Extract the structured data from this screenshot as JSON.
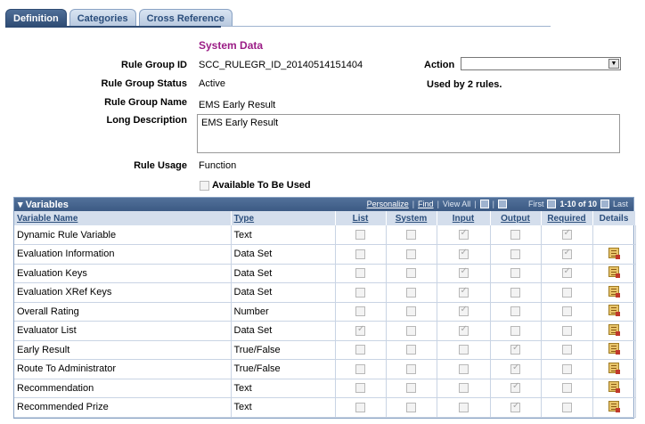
{
  "tabs": [
    {
      "label": "Definition",
      "active": true
    },
    {
      "label": "Categories",
      "active": false
    },
    {
      "label": "Cross Reference",
      "active": false
    }
  ],
  "section_title": "System Data",
  "fields": {
    "rule_group_id_label": "Rule Group ID",
    "rule_group_id_value": "SCC_RULEGR_ID_20140514151404",
    "rule_group_status_label": "Rule Group Status",
    "rule_group_status_value": "Active",
    "rule_group_name_label": "Rule Group Name",
    "rule_group_name_value": "EMS Early Result",
    "long_description_label": "Long Description",
    "long_description_value": "EMS Early Result",
    "rule_usage_label": "Rule Usage",
    "rule_usage_value": "Function",
    "available_label": "Available To Be Used"
  },
  "action": {
    "label": "Action",
    "selected": ""
  },
  "used_by": "Used by 2 rules.",
  "grid": {
    "title": "Variables",
    "nav": {
      "personalize": "Personalize",
      "find": "Find",
      "view_all": "View All",
      "first": "First",
      "range": "1-10 of 10",
      "last": "Last"
    },
    "columns": [
      "Variable Name",
      "Type",
      "List",
      "System",
      "Input",
      "Output",
      "Required",
      "Details"
    ],
    "rows": [
      {
        "name": "Dynamic Rule Variable",
        "type": "Text",
        "list": false,
        "system": false,
        "input": true,
        "output": false,
        "required": true,
        "details": false
      },
      {
        "name": "Evaluation Information",
        "type": "Data Set",
        "list": false,
        "system": false,
        "input": true,
        "output": false,
        "required": true,
        "details": true
      },
      {
        "name": "Evaluation Keys",
        "type": "Data Set",
        "list": false,
        "system": false,
        "input": true,
        "output": false,
        "required": true,
        "details": true
      },
      {
        "name": "Evaluation XRef Keys",
        "type": "Data Set",
        "list": false,
        "system": false,
        "input": true,
        "output": false,
        "required": false,
        "details": true
      },
      {
        "name": "Overall Rating",
        "type": "Number",
        "list": false,
        "system": false,
        "input": true,
        "output": false,
        "required": false,
        "details": true
      },
      {
        "name": "Evaluator List",
        "type": "Data Set",
        "list": true,
        "system": false,
        "input": true,
        "output": false,
        "required": false,
        "details": true
      },
      {
        "name": "Early Result",
        "type": "True/False",
        "list": false,
        "system": false,
        "input": false,
        "output": true,
        "required": false,
        "details": true
      },
      {
        "name": "Route To Administrator",
        "type": "True/False",
        "list": false,
        "system": false,
        "input": false,
        "output": true,
        "required": false,
        "details": true
      },
      {
        "name": "Recommendation",
        "type": "Text",
        "list": false,
        "system": false,
        "input": false,
        "output": true,
        "required": false,
        "details": true
      },
      {
        "name": "Recommended Prize",
        "type": "Text",
        "list": false,
        "system": false,
        "input": false,
        "output": true,
        "required": false,
        "details": true
      }
    ]
  }
}
